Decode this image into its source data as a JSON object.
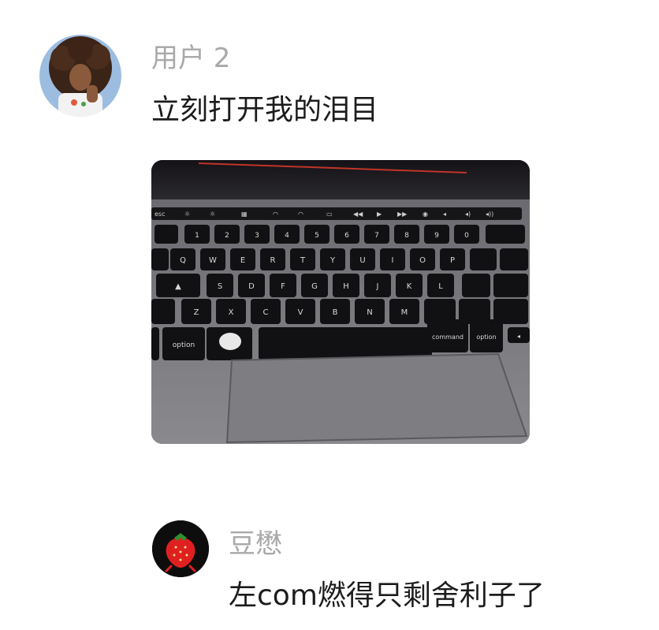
{
  "comments": [
    {
      "username": "用户 2",
      "text": "立刻打开我的泪目",
      "attachment": {
        "keys": {
          "option": "option",
          "command": "command",
          "command_right": "command",
          "option_right": "option",
          "row_numbers": [
            "1",
            "2",
            "3",
            "4",
            "5",
            "6",
            "7",
            "8",
            "9",
            "0"
          ],
          "row_q": [
            "Q",
            "W",
            "E",
            "R",
            "T",
            "Y",
            "U",
            "I",
            "O",
            "P"
          ],
          "row_a": [
            "S",
            "D",
            "F",
            "G",
            "H",
            "J",
            "K",
            "L"
          ],
          "row_z": [
            "Z",
            "X",
            "C",
            "V",
            "B",
            "N",
            "M"
          ]
        }
      }
    },
    {
      "username": "豆懋",
      "text": "左com燃得只剩舍利子了"
    }
  ],
  "colors": {
    "username": "#a9a9a9",
    "text": "#1c1c1c",
    "strawberry": "#e02020",
    "avatar2_bg": "#0d0d0d"
  }
}
